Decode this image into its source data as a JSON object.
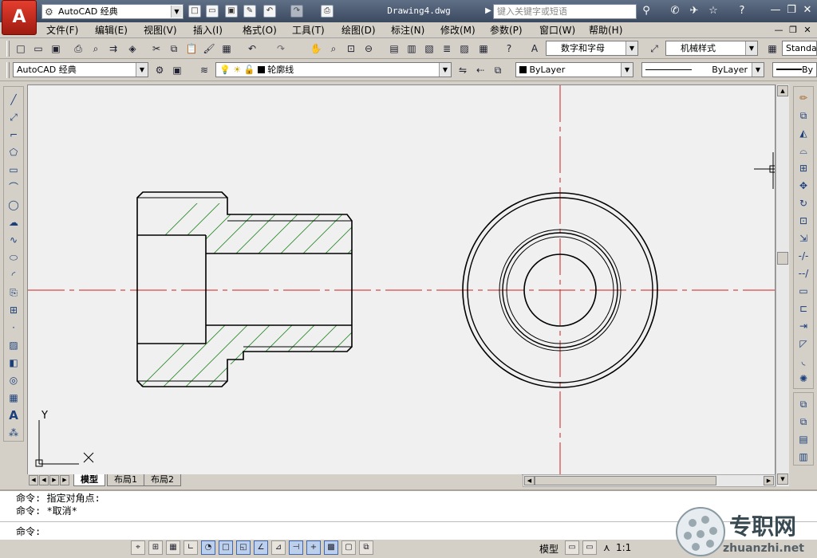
{
  "titlebar": {
    "app_logo_text": "A",
    "workspace": "AutoCAD 经典",
    "document_title": "Drawing4.dwg",
    "search_placeholder": "键入关键字或短语"
  },
  "menus": [
    "文件(F)",
    "编辑(E)",
    "视图(V)",
    "插入(I)",
    "格式(O)",
    "工具(T)",
    "绘图(D)",
    "标注(N)",
    "修改(M)",
    "参数(P)",
    "窗口(W)",
    "帮助(H)"
  ],
  "styles_toolbar": {
    "text_style": "数字和字母",
    "dim_style": "机械样式",
    "table_style": "Standa"
  },
  "workspace_toolbar": {
    "workspace": "AutoCAD 经典",
    "layer": "轮廓线",
    "color": "ByLayer",
    "linetype": "ByLayer",
    "lineweight": "By"
  },
  "ucs": {
    "y_label": "Y",
    "x_label": "X"
  },
  "layout_tabs": [
    {
      "label": "模型",
      "active": true
    },
    {
      "label": "布局1",
      "active": false
    },
    {
      "label": "布局2",
      "active": false
    }
  ],
  "command": {
    "history": [
      "命令: 指定对角点:",
      "命令: *取消*"
    ],
    "prompt": "命令:"
  },
  "statusbar": {
    "model_label": "模型",
    "annotation_scale": "1:1"
  },
  "watermark": {
    "brand": "专职网",
    "url": "zhuanzhi.net"
  },
  "colors": {
    "centerline": "#cc1f1f",
    "hatch": "#2e8b2e",
    "outline": "#000000",
    "canvas_bg": "#f0f0f0"
  }
}
